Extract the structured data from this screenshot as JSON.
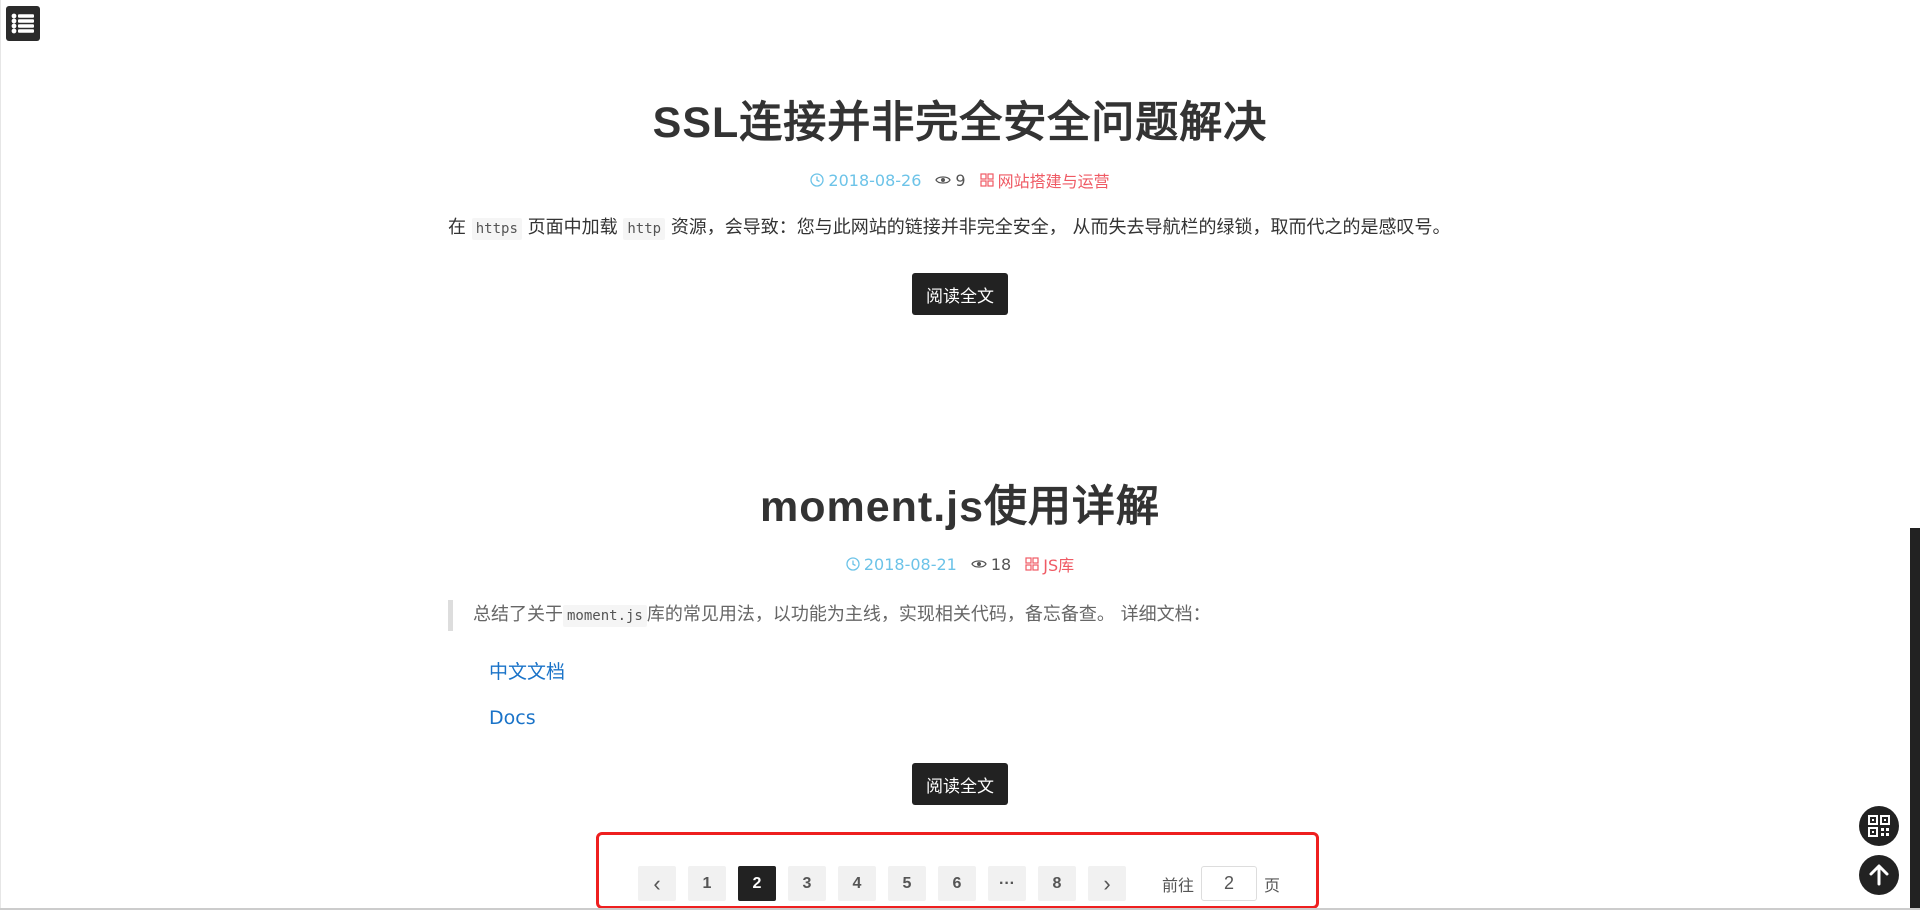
{
  "posts": [
    {
      "title": "SSL连接并非完全安全问题解决",
      "date": "2018-08-26",
      "views": "9",
      "category": "网站搭建与运营",
      "excerpt": {
        "t1": "在",
        "c1": "https",
        "t2": "页面中加载",
        "c2": "http",
        "t3": "资源，会导致：您与此网站的链接并非完全安全， 从而失去导航栏的绿锁，取而代之的是感叹号。"
      },
      "read_more": "阅读全文"
    },
    {
      "title": "moment.js使用详解",
      "date": "2018-08-21",
      "views": "18",
      "category": "JS库",
      "excerpt": {
        "t1": "总结了关于",
        "c1": "moment.js",
        "t2": "库的常见用法，以功能为主线，实现相关代码，备忘备查。 详细文档："
      },
      "links": [
        "中文文档",
        "Docs"
      ],
      "read_more": "阅读全文"
    }
  ],
  "pagination": {
    "prev": "‹",
    "pages": [
      "1",
      "2",
      "3",
      "4",
      "5",
      "6",
      "···",
      "8"
    ],
    "active": "2",
    "next": "›",
    "goto_prefix": "前往",
    "goto_value": "2",
    "goto_suffix": "页"
  },
  "icons": {
    "menu": "menu-icon",
    "clock": "clock-icon",
    "eye": "eye-icon",
    "category": "grid-icon",
    "qrcode": "qrcode-icon",
    "back_to_top": "arrow-up-icon"
  },
  "colors": {
    "date": "#6cc3e8",
    "category": "#ef5a64",
    "link": "#1a73c8",
    "highlight_box": "#ee1f1f",
    "dark": "#222222"
  }
}
